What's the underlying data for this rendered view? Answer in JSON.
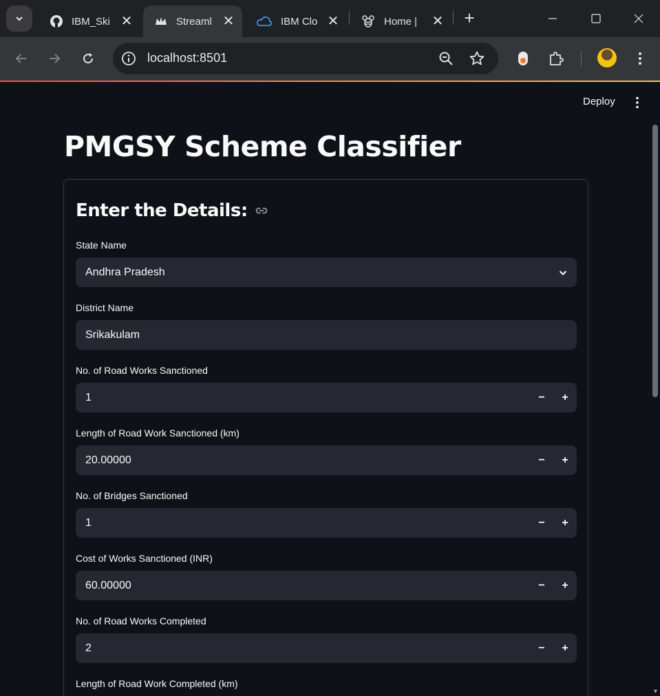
{
  "browser": {
    "tabs": [
      {
        "title": "IBM_Ski",
        "icon": "github-icon"
      },
      {
        "title": "Streaml",
        "icon": "streamlit-crown-icon",
        "active": true
      },
      {
        "title": "IBM Clo",
        "icon": "ibm-cloud-icon"
      },
      {
        "title": "Home |",
        "icon": "bee-icon"
      }
    ],
    "url": "localhost:8501"
  },
  "header": {
    "deploy_label": "Deploy"
  },
  "main": {
    "title": "PMGSY Scheme Classifier",
    "form": {
      "heading": "Enter the Details:",
      "fields": [
        {
          "label": "State Name",
          "value": "Andhra Pradesh",
          "type": "select"
        },
        {
          "label": "District Name",
          "value": "Srikakulam",
          "type": "text"
        },
        {
          "label": "No. of Road Works Sanctioned",
          "value": "1",
          "type": "number"
        },
        {
          "label": "Length of Road Work Sanctioned (km)",
          "value": "20.00000",
          "type": "number"
        },
        {
          "label": "No. of Bridges Sanctioned",
          "value": "1",
          "type": "number"
        },
        {
          "label": "Cost of Works Sanctioned (INR)",
          "value": "60.00000",
          "type": "number"
        },
        {
          "label": "No. of Road Works Completed",
          "value": "2",
          "type": "number"
        },
        {
          "label": "Length of Road Work Completed (km)",
          "value": "",
          "type": "number"
        }
      ],
      "stepper": {
        "minus": "−",
        "plus": "+"
      }
    }
  }
}
